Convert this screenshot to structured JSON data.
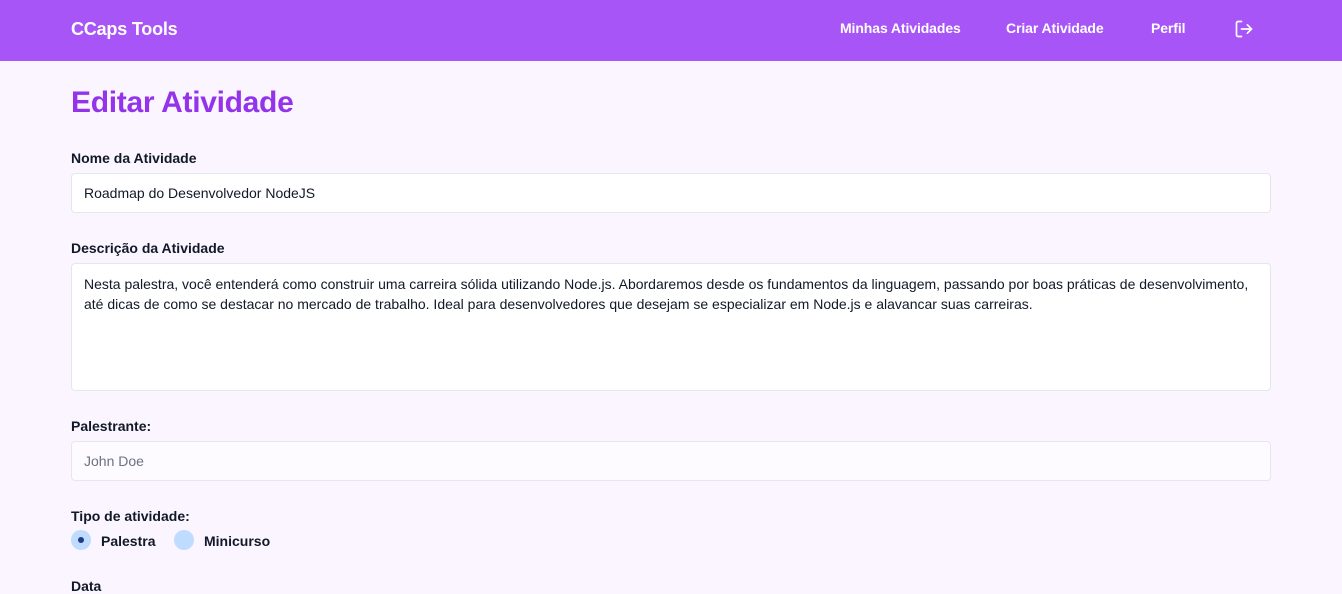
{
  "navbar": {
    "brand": "CCaps Tools",
    "links": [
      {
        "label": "Minhas Atividades"
      },
      {
        "label": "Criar Atividade"
      },
      {
        "label": "Perfil"
      }
    ],
    "logout_icon": "logout-icon"
  },
  "page": {
    "title": "Editar Atividade"
  },
  "form": {
    "name_label": "Nome da Atividade",
    "name_value": "Roadmap do Desenvolvedor NodeJS",
    "description_label": "Descrição da Atividade",
    "description_value": "Nesta palestra, você entenderá como construir uma carreira sólida utilizando Node.js. Abordaremos desde os fundamentos da linguagem, passando por boas práticas de desenvolvimento, até dicas de como se destacar no mercado de trabalho. Ideal para desenvolvedores que desejam se especializar em Node.js e alavancar suas carreiras.",
    "speaker_label": "Palestrante:",
    "speaker_placeholder": "John Doe",
    "type_label": "Tipo de atividade:",
    "type_options": [
      {
        "label": "Palestra",
        "selected": true
      },
      {
        "label": "Minicurso",
        "selected": false
      }
    ],
    "date_label": "Data"
  },
  "colors": {
    "navbar": "#a855f7",
    "title": "#9333ea",
    "background": "#faf5ff",
    "radio": "#bfdbfe"
  }
}
